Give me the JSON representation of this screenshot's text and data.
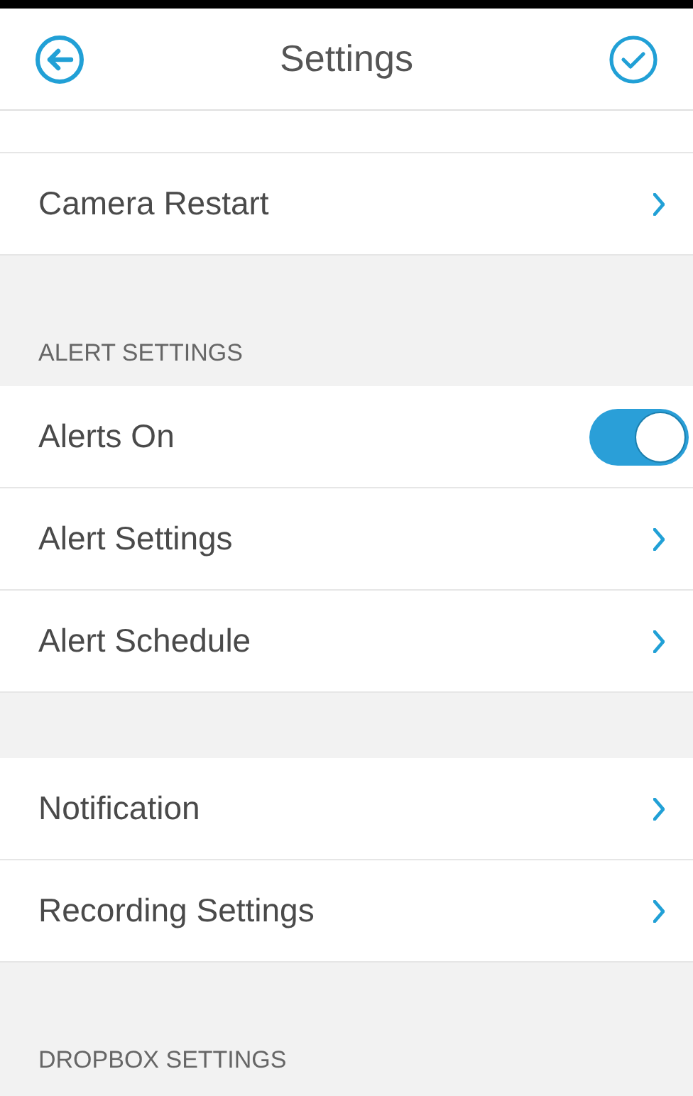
{
  "header": {
    "title": "Settings"
  },
  "items": [
    {
      "kind": "row",
      "label": "Camera Restart"
    },
    {
      "kind": "gap"
    },
    {
      "kind": "section",
      "label": "ALERT SETTINGS"
    },
    {
      "kind": "toggle",
      "label": "Alerts On",
      "on": true
    },
    {
      "kind": "row",
      "label": "Alert Settings"
    },
    {
      "kind": "row",
      "label": "Alert Schedule"
    },
    {
      "kind": "gap"
    },
    {
      "kind": "row",
      "label": "Notification"
    },
    {
      "kind": "row",
      "label": "Recording Settings"
    },
    {
      "kind": "gap"
    },
    {
      "kind": "section",
      "label": "DROPBOX SETTINGS"
    }
  ]
}
